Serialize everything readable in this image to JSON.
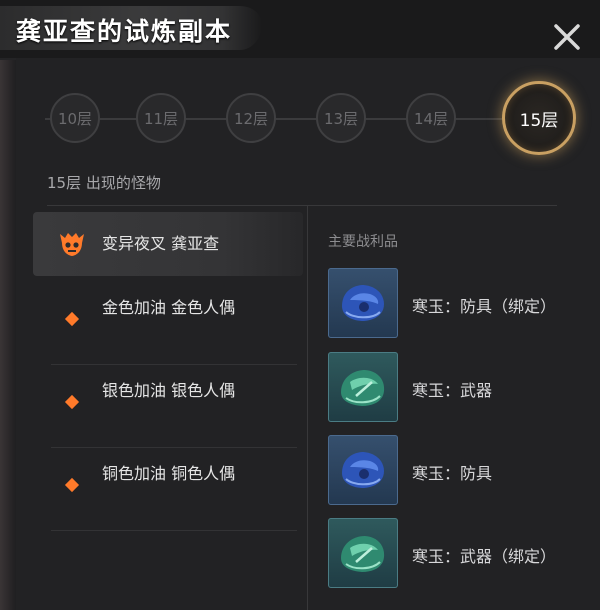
{
  "window": {
    "title": "龚亚查的试炼副本"
  },
  "floors": [
    {
      "label": "10层",
      "active": false
    },
    {
      "label": "11层",
      "active": false
    },
    {
      "label": "12层",
      "active": false
    },
    {
      "label": "13层",
      "active": false
    },
    {
      "label": "14层",
      "active": false
    },
    {
      "label": "15层",
      "active": true
    }
  ],
  "monsters_section": {
    "title": "15层 出现的怪物",
    "items": [
      {
        "name": "变异夜叉 龚亚查",
        "icon": "boss-skull-icon",
        "selected": true
      },
      {
        "name": "金色加油 金色人偶",
        "icon": "orange-diamond-icon",
        "selected": false
      },
      {
        "name": "银色加油 银色人偶",
        "icon": "orange-diamond-icon",
        "selected": false
      },
      {
        "name": "铜色加油 铜色人偶",
        "icon": "orange-diamond-icon",
        "selected": false
      }
    ]
  },
  "loot_section": {
    "title": "主要战利品",
    "items": [
      {
        "name": "寒玉：防具（绑定）",
        "icon": "blue-armor-gem-icon"
      },
      {
        "name": "寒玉：武器",
        "icon": "green-weapon-gem-icon"
      },
      {
        "name": "寒玉：防具",
        "icon": "blue-armor-gem-icon"
      },
      {
        "name": "寒玉：武器（绑定）",
        "icon": "green-weapon-gem-icon"
      }
    ]
  },
  "colors": {
    "accent_orange": "#ff7a2a",
    "active_ring": "#c9a062",
    "background": "#222224"
  }
}
